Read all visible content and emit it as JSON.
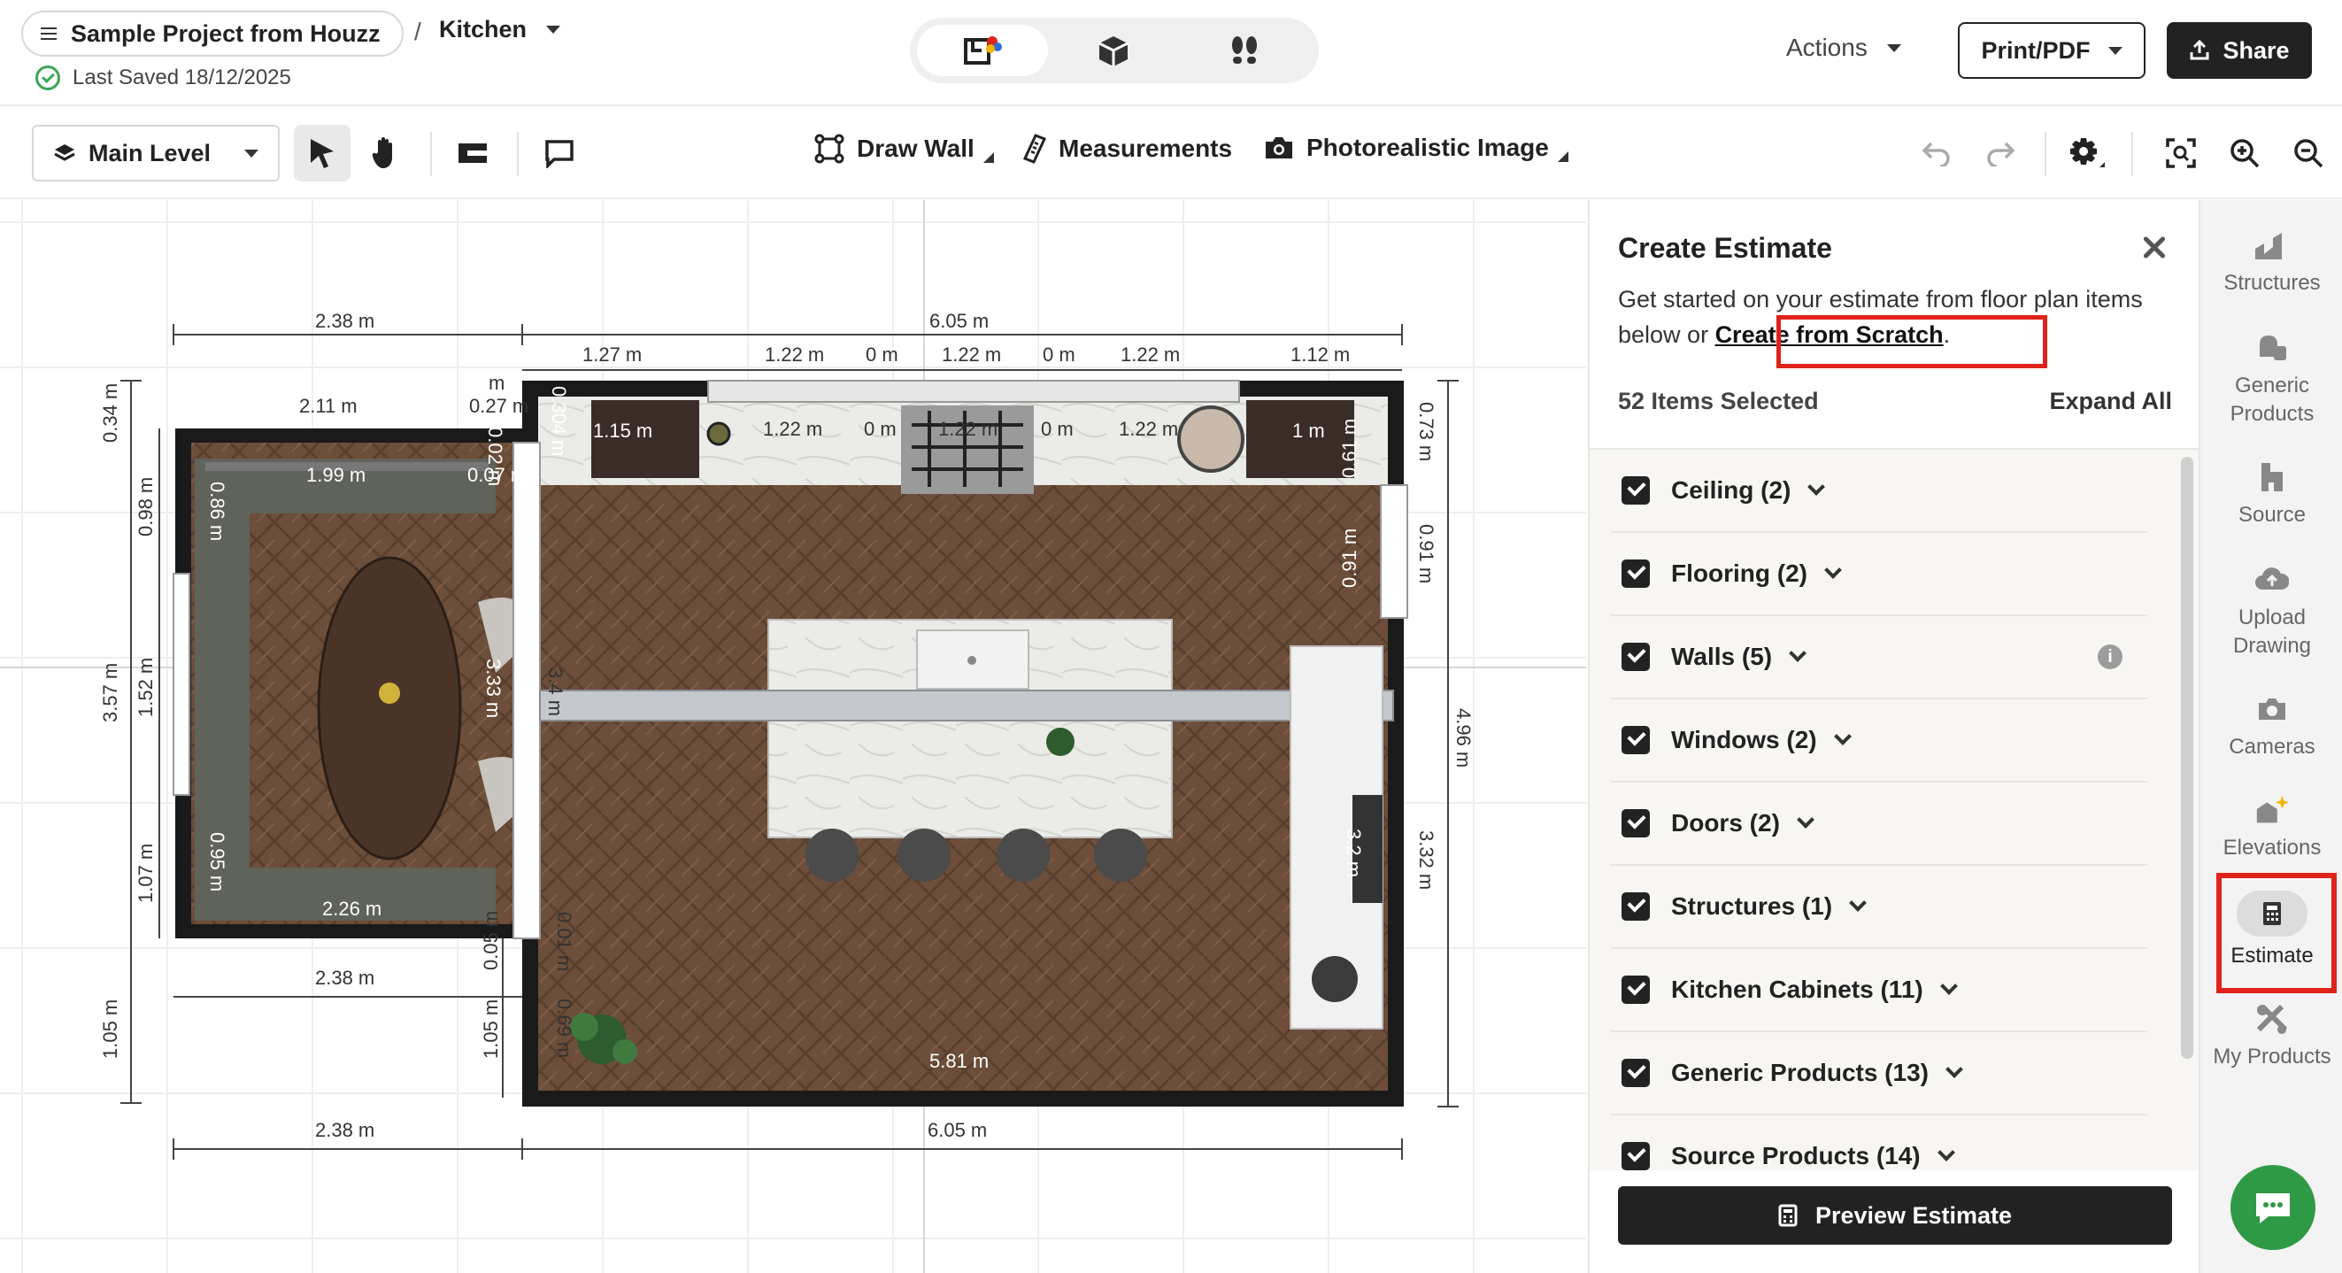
{
  "header": {
    "project_name": "Sample Project from Houzz",
    "separator": "/",
    "room_name": "Kitchen",
    "last_saved": "Last Saved 18/12/2025",
    "actions_label": "Actions",
    "print_label": "Print/PDF",
    "share_label": "Share",
    "views": [
      "2d-plan-icon",
      "3d-box-icon",
      "walkthrough-icon"
    ]
  },
  "toolbar": {
    "level_label": "Main Level",
    "draw_wall_label": "Draw Wall",
    "measurements_label": "Measurements",
    "photoreal_label": "Photorealistic Image"
  },
  "plan": {
    "dims": [
      "2.38 m",
      "6.05 m",
      "1.27 m",
      "1.22 m",
      "0 m",
      "1.22 m",
      "0 m",
      "1.22 m",
      "1.12 m",
      "2.11 m",
      "0.27 m",
      "1.15 m",
      "1.22 m",
      "0 m",
      "1.22 m",
      "0 m",
      "1.22 m",
      "1 m",
      "1.99 m",
      "0.07 m",
      "0.34 m",
      "0.98 m",
      "3.57 m",
      "1.52 m",
      "1.07 m",
      "1.05 m",
      "0.86 m",
      "0.95 m",
      "3.33 m",
      "3.4 m",
      "0.73 m",
      "0.91 m",
      "4.96 m",
      "3.32 m",
      "0.61 m",
      "0.91 m",
      "2.26 m",
      "2.38 m",
      "2.38 m",
      "6.05 m",
      "5.81 m",
      "0.05 m",
      "1.05 m",
      "0.01 m",
      "0.69 m",
      "3.2 m",
      "m",
      "0.02 m",
      "0.304 m"
    ]
  },
  "panel": {
    "title": "Create Estimate",
    "desc_prefix": "Get started on your estimate from floor plan items below or ",
    "desc_link": "Create from Scratch",
    "desc_suffix": ".",
    "count": "52 Items Selected",
    "expand_all": "Expand All",
    "items": [
      {
        "label": "Ceiling (2)"
      },
      {
        "label": "Flooring (2)"
      },
      {
        "label": "Walls (5)"
      },
      {
        "label": "Windows (2)"
      },
      {
        "label": "Doors (2)"
      },
      {
        "label": "Structures (1)"
      },
      {
        "label": "Kitchen Cabinets (11)"
      },
      {
        "label": "Generic Products (13)"
      },
      {
        "label": "Source Products (14)"
      }
    ],
    "preview_label": "Preview Estimate"
  },
  "rail": {
    "items": [
      {
        "label": "Structures",
        "icon": "structures-icon"
      },
      {
        "label": "Generic Products",
        "icon": "generic-products-icon"
      },
      {
        "label": "Source",
        "icon": "source-icon"
      },
      {
        "label": "Upload Drawing",
        "icon": "upload-icon"
      },
      {
        "label": "Cameras",
        "icon": "camera-icon"
      },
      {
        "label": "Elevations",
        "icon": "elevations-icon"
      },
      {
        "label": "Estimate",
        "icon": "calculator-icon"
      },
      {
        "label": "My Products",
        "icon": "my-products-icon"
      }
    ]
  },
  "colors": {
    "highlight": "#e0231a",
    "chat": "#2f9a45",
    "floor": "#6d4e3a",
    "wall": "#1a1a1a"
  }
}
